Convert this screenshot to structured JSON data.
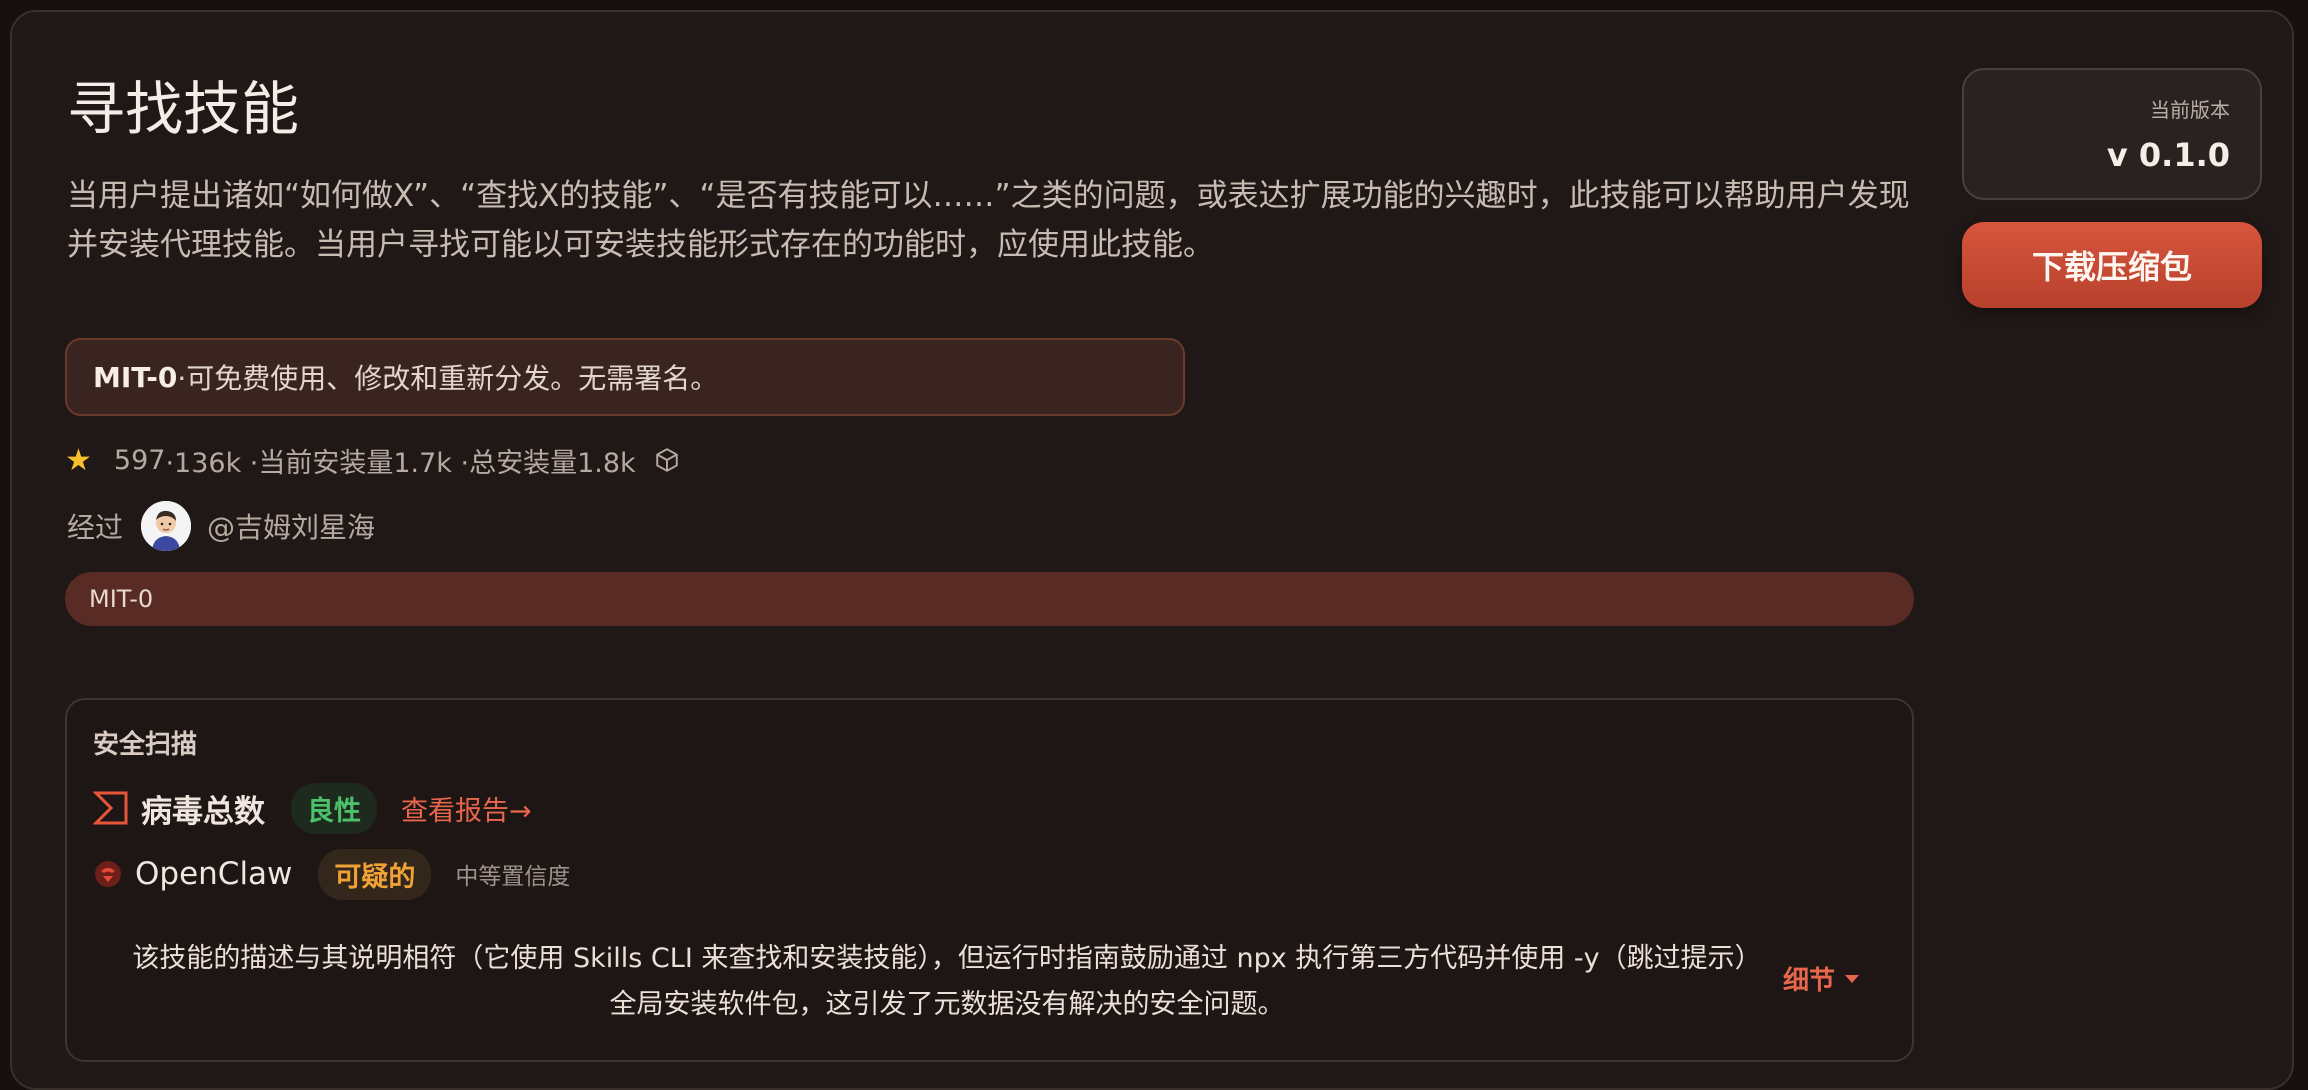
{
  "skill": {
    "title": "寻找技能",
    "description": "当用户提出诸如“如何做X”、“查找X的技能”、“是否有技能可以……”之类的问题，或表达扩展功能的兴趣时，此技能可以帮助用户发现并安装代理技能。当用户寻找可能以可安装技能形式存在的功能时，应使用此技能。"
  },
  "license_note": {
    "name": "MIT-0",
    "text": " ·可免费使用、修改和重新分发。无需署名。"
  },
  "stats": {
    "stars": "597",
    "rest": " ·136k ·当前安装量1.7k ·总安装量1.8k"
  },
  "author": {
    "by_label": "经过",
    "handle": "@吉姆刘星海"
  },
  "tags": [
    "MIT-0"
  ],
  "security_scan": {
    "title": "安全扫描",
    "virustotal": {
      "name": "病毒总数",
      "verdict": "良性",
      "report_link": "查看报告→",
      "verdict_color": "#4bc26a"
    },
    "openclaw": {
      "name": "OpenClaw",
      "verdict": "可疑的",
      "confidence": "中等置信度",
      "verdict_color": "#f0a236"
    },
    "explanation": "该技能的描述与其说明相符（它使用 Skills CLI 来查找和安装技能），但运行时指南鼓励通过 npx 执行第三方代码并使用 -y（跳过提示）全局安装软件包，这引发了元数据没有解决的安全问题。",
    "details_label": "细节"
  },
  "sidebar": {
    "version_label": "当前版本",
    "version_value": "v 0.1.0",
    "download_label": "下载压缩包",
    "accent": "#c94a33"
  },
  "icons": {
    "star": "star-icon",
    "package": "package-icon",
    "virustotal": "virustotal-icon",
    "openclaw": "openclaw-icon",
    "caret": "caret-down-icon"
  }
}
